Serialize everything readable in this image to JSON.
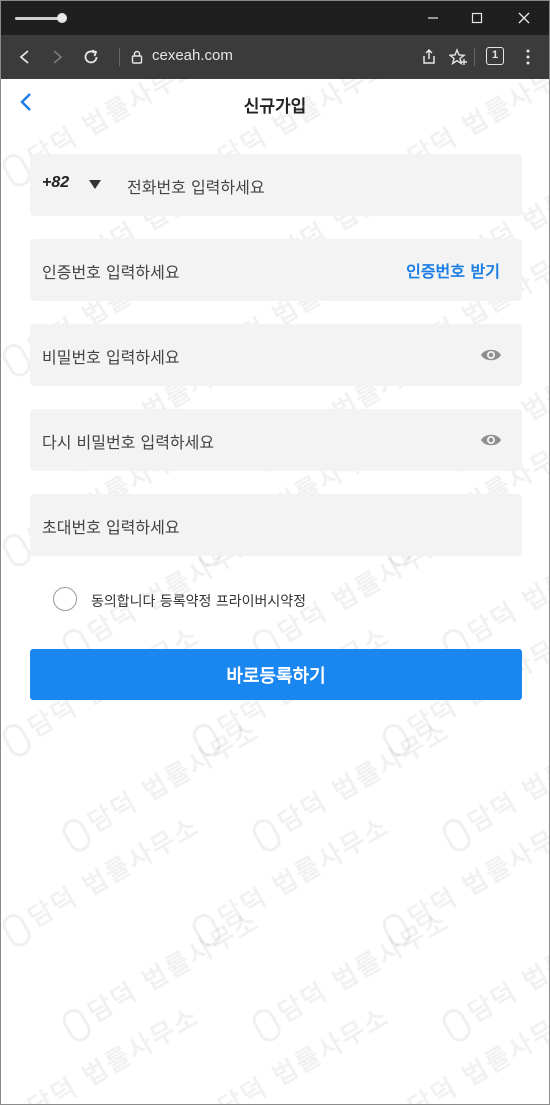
{
  "browser": {
    "url": "cexeah.com",
    "tab_count": "1"
  },
  "header": {
    "title": "신규가입"
  },
  "form": {
    "country_code": "+82",
    "phone_placeholder": "전화번호 입력하세요",
    "code_placeholder": "인증번호 입력하세요",
    "code_link": "인증번호 받기",
    "password_placeholder": "비밀번호 입력하세요",
    "password_confirm_placeholder": "다시 비밀번호 입력하세요",
    "invite_placeholder": "초대번호 입력하세요",
    "agree_text": "동의합니다 등록약정 프라이버시약정",
    "submit_label": "바로등록하기"
  },
  "watermark": {
    "text": "담덕 법률사무소"
  },
  "colors": {
    "accent": "#1a87f0",
    "link": "#1a7ee5",
    "field_bg": "#f3f3f3",
    "titlebar": "#1f1f1f",
    "toolbar": "#3b3b3b"
  }
}
